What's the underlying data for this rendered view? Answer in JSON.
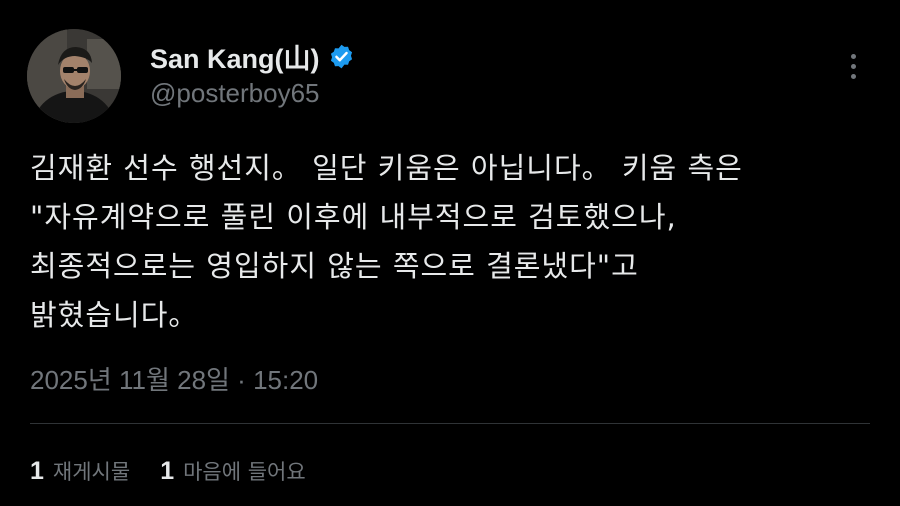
{
  "author": {
    "display_name": "San Kang(山)",
    "handle": "@posterboy65",
    "verified": true,
    "verified_color": "#1d9bf0",
    "avatar_icon": "profile-photo"
  },
  "menu": {
    "icon": "more-vertical-icon"
  },
  "tweet": {
    "lines": [
      "김재환 선수 행선지。 일단 키움은 아닙니다。 키움 측은",
      "\"자유계약으로 풀린 이후에 내부적으로 검토했으나,",
      "최종적으로는 영입하지 않는 쪽으로 결론냈다\"고",
      "밝혔습니다。"
    ],
    "timestamp": "2025년 11월 28일 · 15:20"
  },
  "stats": {
    "retweets": {
      "count": "1",
      "label": "재게시물"
    },
    "likes": {
      "count": "1",
      "label": "마음에 들어요"
    }
  },
  "colors": {
    "background": "#000000",
    "text_primary": "#e7e9ea",
    "text_secondary": "#71767b",
    "divider": "#2f3336"
  }
}
